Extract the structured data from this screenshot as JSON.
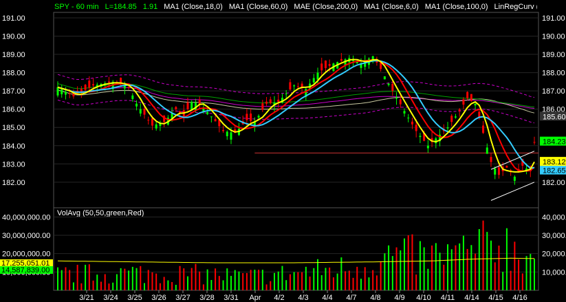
{
  "header": {
    "symbol": "SPY - 60 min",
    "last": "L=184.85",
    "change": "1.91",
    "indicators": [
      "MA1 (Close,18,0)",
      "MA1 (Close,60,0)",
      "MAE (Close,200,0)",
      "MA1 (Close,6,0)",
      "MA1 (Close,100,0)",
      "LinRegCurv (Cl"
    ]
  },
  "volume_panel": {
    "title": "VolAvg (50,50,green,Red)"
  },
  "colors": {
    "background": "#000000",
    "grid": "#262626",
    "up": "#00ff00",
    "down": "#ff0000",
    "ma6": "#ffff00",
    "ma18": "#ff0000",
    "ma60": "#33ccff",
    "mae200": "#cc00cc",
    "ma100": "#c8c8a0",
    "long": "#00a000",
    "linreg": "#ffffff"
  },
  "chart_data": [
    {
      "type": "candlestick",
      "title": "SPY - 60 min",
      "y_axis_left": [
        "191.00",
        "190.00",
        "189.00",
        "188.00",
        "187.00",
        "186.00",
        "185.00",
        "184.00",
        "183.00",
        "182.00"
      ],
      "y_axis_right": [
        "191.00",
        "190.00",
        "189.00",
        "188.00",
        "187.00",
        "186.00",
        "184.23",
        "183.12",
        "182.65",
        "182.00"
      ],
      "ylim": [
        180.6,
        191.3
      ],
      "x_labels": [
        "3/21",
        "3/24",
        "3/25",
        "3/26",
        "3/27",
        "3/28",
        "3/31",
        "Apr",
        "4/2",
        "4/3",
        "4/4",
        "4/7",
        "4/8",
        "4/9",
        "4/10",
        "4/11",
        "4/14",
        "4/15",
        "4/16"
      ],
      "price_path": [
        [
          0,
          187.2
        ],
        [
          4,
          186.7
        ],
        [
          9,
          187.3
        ],
        [
          14,
          187.5
        ],
        [
          18,
          187.2
        ],
        [
          20,
          186.3
        ],
        [
          24,
          185.1
        ],
        [
          27,
          185.3
        ],
        [
          30,
          186.0
        ],
        [
          32,
          185.6
        ],
        [
          34,
          186.4
        ],
        [
          36,
          186.3
        ],
        [
          39,
          185.6
        ],
        [
          42,
          184.8
        ],
        [
          45,
          184.7
        ],
        [
          48,
          185.4
        ],
        [
          50,
          185.3
        ],
        [
          53,
          186.3
        ],
        [
          56,
          186.4
        ],
        [
          60,
          187.3
        ],
        [
          63,
          187.1
        ],
        [
          66,
          188.0
        ],
        [
          70,
          188.5
        ],
        [
          74,
          188.8
        ],
        [
          77,
          188.5
        ],
        [
          80,
          188.9
        ],
        [
          82,
          188.2
        ],
        [
          85,
          187.0
        ],
        [
          88,
          185.9
        ],
        [
          91,
          184.8
        ],
        [
          94,
          184.0
        ],
        [
          96,
          184.4
        ],
        [
          99,
          185.0
        ],
        [
          102,
          185.9
        ],
        [
          104,
          186.6
        ],
        [
          106,
          186.3
        ],
        [
          108,
          184.7
        ],
        [
          110,
          183.1
        ],
        [
          112,
          182.4
        ],
        [
          114,
          182.8
        ],
        [
          116,
          182.3
        ],
        [
          118,
          182.9
        ],
        [
          120,
          182.6
        ],
        [
          121,
          184.2
        ]
      ],
      "series_tags": [
        {
          "name": "MA100",
          "value": "185.60"
        },
        {
          "name": "MA60",
          "value": "182.65"
        },
        {
          "name": "MA6",
          "value": "183.12"
        },
        {
          "name": "Last",
          "value": "184.23"
        }
      ],
      "horizontal_line": 183.6
    },
    {
      "type": "bar",
      "title": "VolAvg (50,50,green,Red)",
      "y_axis_left": [
        "40,000,000.00",
        "30,000,000.00",
        "20,000,000.00",
        "10,000,000.00"
      ],
      "y_axis_right": [
        "40,000.00",
        "30,000.00",
        "20,000.00",
        "10,000.00"
      ],
      "ylim": [
        0,
        42000000
      ],
      "value_tags": [
        "17,255,051.01",
        "14,587,839.00"
      ],
      "volume_path": [
        [
          0,
          8
        ],
        [
          20,
          9
        ],
        [
          40,
          8
        ],
        [
          48,
          7
        ],
        [
          60,
          9
        ],
        [
          75,
          12
        ],
        [
          85,
          18
        ],
        [
          95,
          17
        ],
        [
          105,
          20
        ],
        [
          112,
          25
        ],
        [
          121,
          18
        ]
      ],
      "avg_path": [
        [
          0,
          16
        ],
        [
          20,
          15.5
        ],
        [
          40,
          15
        ],
        [
          60,
          15
        ],
        [
          80,
          15.5
        ],
        [
          95,
          16
        ],
        [
          105,
          17
        ],
        [
          115,
          17.5
        ],
        [
          121,
          17.3
        ]
      ]
    }
  ]
}
